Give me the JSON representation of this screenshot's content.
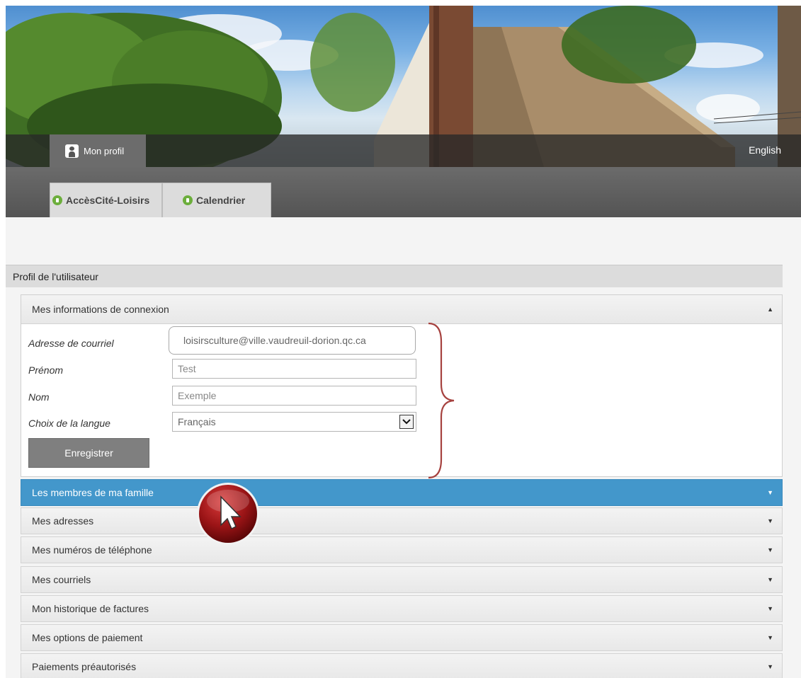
{
  "header": {
    "profile_label": "Mon profil",
    "language_link": "English"
  },
  "nav": {
    "tabs": [
      {
        "label": "AccèsCité-Loisirs"
      },
      {
        "label": "Calendrier"
      }
    ]
  },
  "section": {
    "title": "Profil de l'utilisateur"
  },
  "login_panel": {
    "title": "Mes informations de connexion",
    "fields": {
      "email": {
        "label": "Adresse de courriel",
        "value": "loisirsculture@ville.vaudreuil-dorion.qc.ca"
      },
      "first_name": {
        "label": "Prénom",
        "value": "Test"
      },
      "last_name": {
        "label": "Nom",
        "value": "Exemple"
      },
      "language": {
        "label": "Choix de la langue",
        "value": "Français"
      }
    },
    "save_label": "Enregistrer"
  },
  "accordion": [
    {
      "label": "Les membres de ma famille",
      "active": true
    },
    {
      "label": "Mes adresses"
    },
    {
      "label": "Mes numéros de téléphone"
    },
    {
      "label": "Mes courriels"
    },
    {
      "label": "Mon historique de factures"
    },
    {
      "label": "Mes options de paiement"
    },
    {
      "label": "Paiements préautorisés"
    }
  ],
  "colors": {
    "accent": "#4397cb",
    "tab_dot": "#6cae3c",
    "brace": "#a6423f",
    "cursor_badge": "#8b0f12"
  },
  "icons": {
    "profile": "user-icon",
    "tab": "info-dot-icon",
    "collapse": "triangle-up-icon",
    "expand": "triangle-down-icon",
    "select": "chevron-down-icon",
    "annotation": "cursor-pointer-icon"
  }
}
